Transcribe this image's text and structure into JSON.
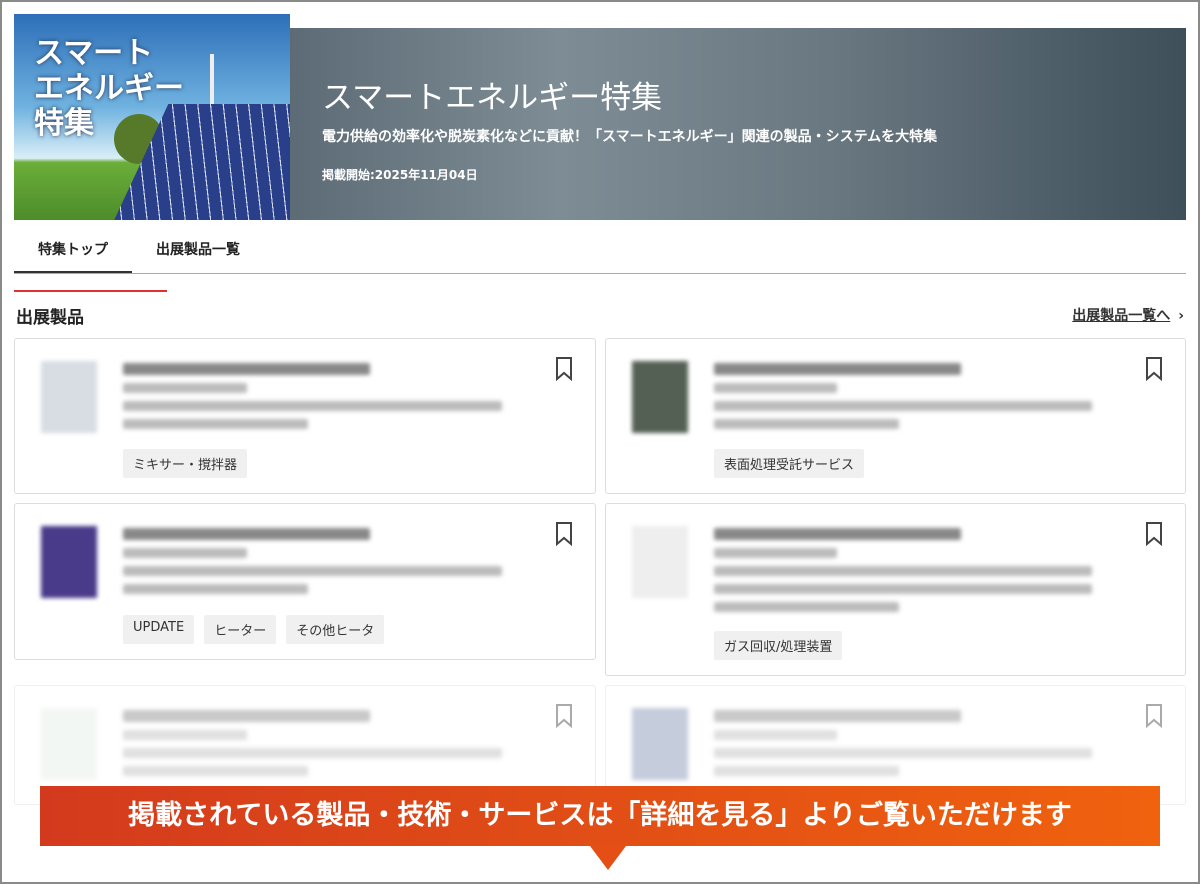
{
  "hero": {
    "logo_text": "スマート エネルギー 特集",
    "title": "スマートエネルギー特集",
    "subtitle": "電力供給の効率化や脱炭素化などに貢献！「スマートエネルギー」関連の製品・システムを大特集",
    "date": "掲載開始:2025年11月04日"
  },
  "tabs": [
    {
      "label": "特集トップ",
      "active": true
    },
    {
      "label": "出展製品一覧",
      "active": false
    }
  ],
  "section": {
    "title": "出展製品",
    "all_link": "出展製品一覧へ"
  },
  "cards": [
    {
      "tags": [
        "ミキサー・撹拌器"
      ]
    },
    {
      "tags": [
        "表面処理受託サービス"
      ]
    },
    {
      "tags": [
        "UPDATE",
        "ヒーター",
        "その他ヒータ"
      ]
    },
    {
      "tags": [
        "ガス回収/処理装置"
      ]
    },
    {
      "tags": []
    },
    {
      "tags": []
    }
  ],
  "callout": "掲載されている製品・技術・サービスは「詳細を見る」よりご覧いただけます"
}
